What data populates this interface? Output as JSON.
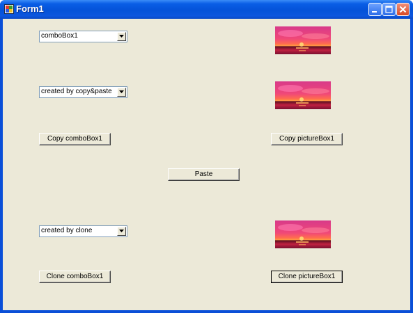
{
  "window": {
    "title": "Form1"
  },
  "controls": {
    "combo1": {
      "text": "comboBox1"
    },
    "combo2": {
      "text": "created by copy&paste"
    },
    "combo3": {
      "text": "created by clone"
    },
    "copy_combo_button": "Copy comboBox1",
    "copy_picture_button": "Copy pictureBox1",
    "paste_button": "Paste",
    "clone_combo_button": "Clone comboBox1",
    "clone_picture_button": "Clone pictureBox1"
  },
  "pictures": [
    "sunset-image",
    "sunset-image",
    "sunset-image"
  ],
  "colors": {
    "titlebar": "#0a54d8",
    "client": "#ece9d8",
    "sunset_sky": "#d83a8a",
    "sunset_sun": "#ffd070"
  }
}
